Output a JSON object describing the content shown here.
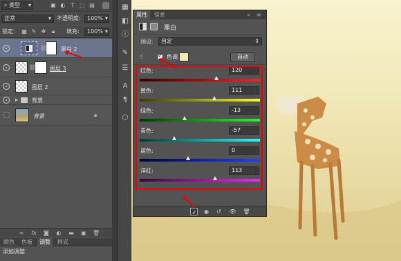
{
  "layers_panel": {
    "filter_label": "类型",
    "blend_mode": "正常",
    "opacity_label": "不透明度:",
    "opacity_value": "100%",
    "lock_label": "锁定:",
    "fill_label": "填充:",
    "fill_value": "100%",
    "layers": [
      {
        "name": "黑白 2",
        "selected": true
      },
      {
        "name": "图层 3",
        "selected": false
      },
      {
        "name": "图层 2",
        "selected": false
      },
      {
        "name": "背景",
        "selected": false
      },
      {
        "name": "背景",
        "selected": false
      }
    ],
    "bottom_tabs": [
      "颜色",
      "色板",
      "调整",
      "样式"
    ],
    "active_tab": "调整",
    "add_adjustment": "添加调整"
  },
  "properties_panel": {
    "tabs": [
      "属性",
      "信息"
    ],
    "active_tab": "属性",
    "adjustment_name": "黑白",
    "preset_label": "预设:",
    "preset_value": "自定",
    "tint_label": "色调",
    "tint_checked": true,
    "tint_color": "#f5e6b8",
    "auto_button": "自动",
    "sliders": [
      {
        "label": "红色:",
        "value": "120",
        "colors": [
          "#3a0000",
          "#ff2020"
        ]
      },
      {
        "label": "黄色:",
        "value": "111",
        "colors": [
          "#3a3a00",
          "#ffff20"
        ]
      },
      {
        "label": "绿色:",
        "value": "-13",
        "colors": [
          "#003a00",
          "#20ff20"
        ]
      },
      {
        "label": "青色:",
        "value": "-57",
        "colors": [
          "#003a3a",
          "#20ffff"
        ]
      },
      {
        "label": "蓝色:",
        "value": "0",
        "colors": [
          "#00003a",
          "#2040ff"
        ]
      },
      {
        "label": "洋红:",
        "value": "113",
        "colors": [
          "#3a003a",
          "#ff20ff"
        ]
      }
    ],
    "slider_range": [
      -200,
      300
    ]
  },
  "colors": {
    "accent_red": "#e00000",
    "panel_bg": "#535353"
  }
}
